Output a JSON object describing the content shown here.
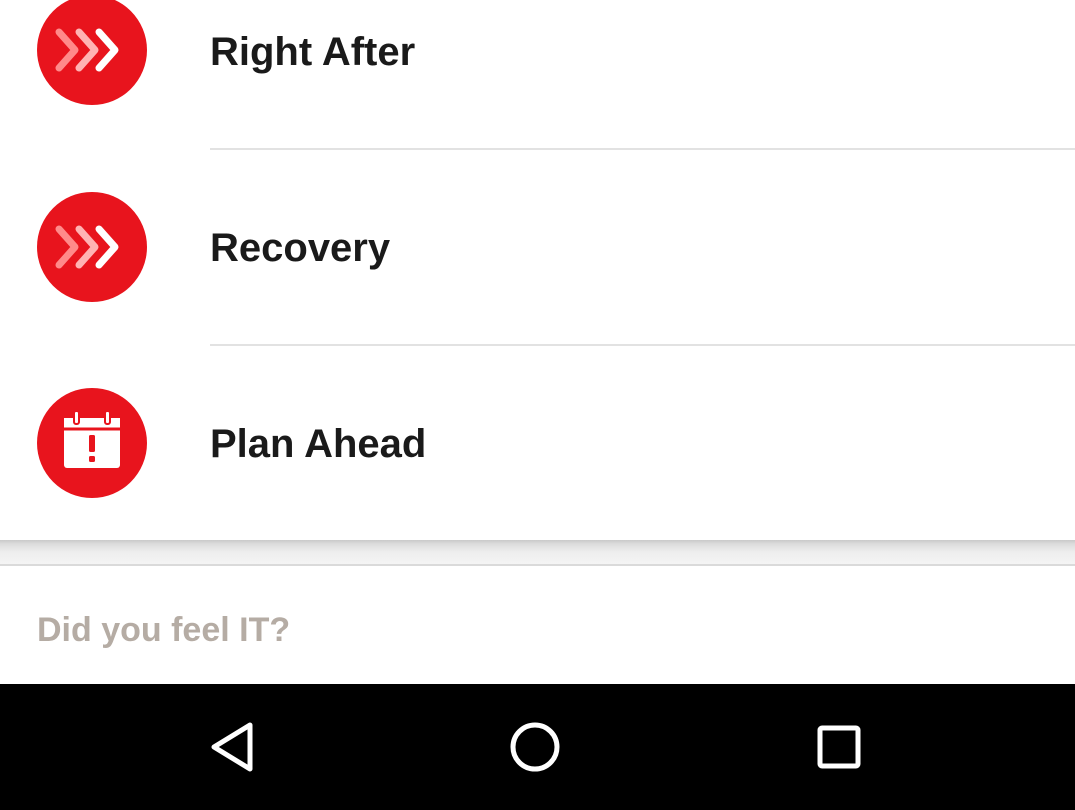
{
  "menu": {
    "items": [
      {
        "label": "Right After",
        "icon": "fast-forward-icon"
      },
      {
        "label": "Recovery",
        "icon": "fast-forward-icon"
      },
      {
        "label": "Plan Ahead",
        "icon": "calendar-alert-icon"
      }
    ],
    "accent_color": "#e8141d"
  },
  "footer": {
    "prompt": "Did you feel IT?"
  },
  "navigation_bar": {
    "buttons": [
      {
        "name": "back",
        "icon": "back-triangle-icon"
      },
      {
        "name": "home",
        "icon": "home-circle-icon"
      },
      {
        "name": "recents",
        "icon": "recents-square-icon"
      }
    ]
  }
}
